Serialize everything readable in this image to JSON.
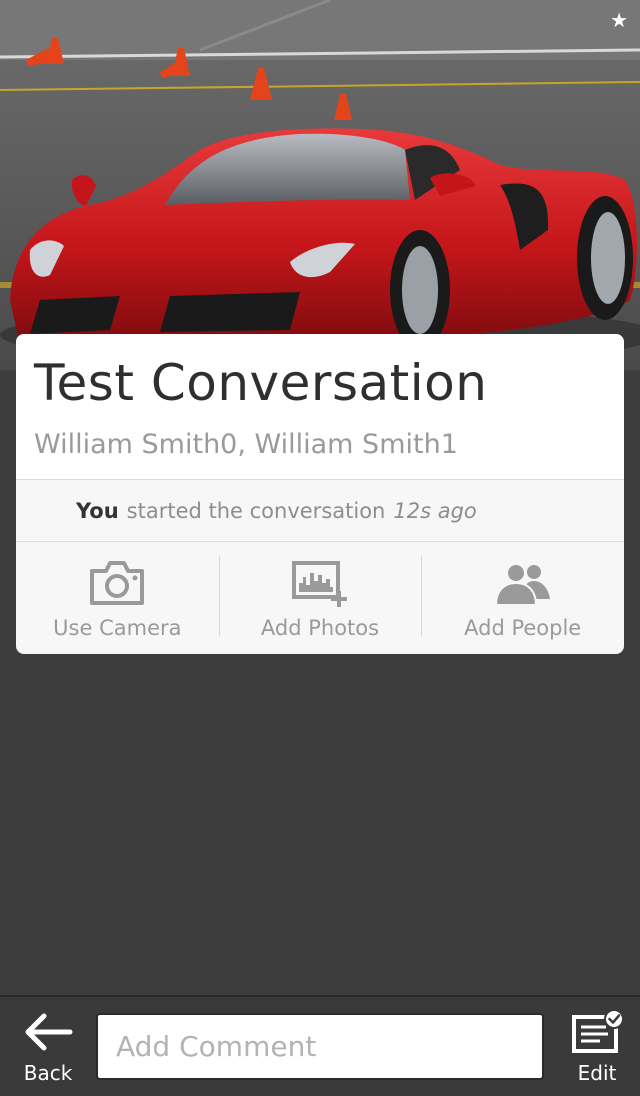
{
  "cover": {
    "favorite_icon": "star-icon",
    "favorite_glyph": "★",
    "description_icon": "red-sports-car-photo"
  },
  "conversation": {
    "title": "Test Conversation",
    "participants": "William Smith0, William Smith1",
    "activity": {
      "actor": "You",
      "action": "started the conversation",
      "time": "12s ago"
    }
  },
  "actions": [
    {
      "label": "Use Camera",
      "icon": "camera-icon"
    },
    {
      "label": "Add Photos",
      "icon": "add-photos-icon"
    },
    {
      "label": "Add People",
      "icon": "add-people-icon"
    }
  ],
  "bottombar": {
    "back_label": "Back",
    "back_icon": "back-arrow-icon",
    "comment_placeholder": "Add Comment",
    "edit_label": "Edit",
    "edit_icon": "edit-icon"
  },
  "colors": {
    "background": "#3d3d3d",
    "card": "#f7f7f7",
    "car_red": "#d11f22"
  }
}
